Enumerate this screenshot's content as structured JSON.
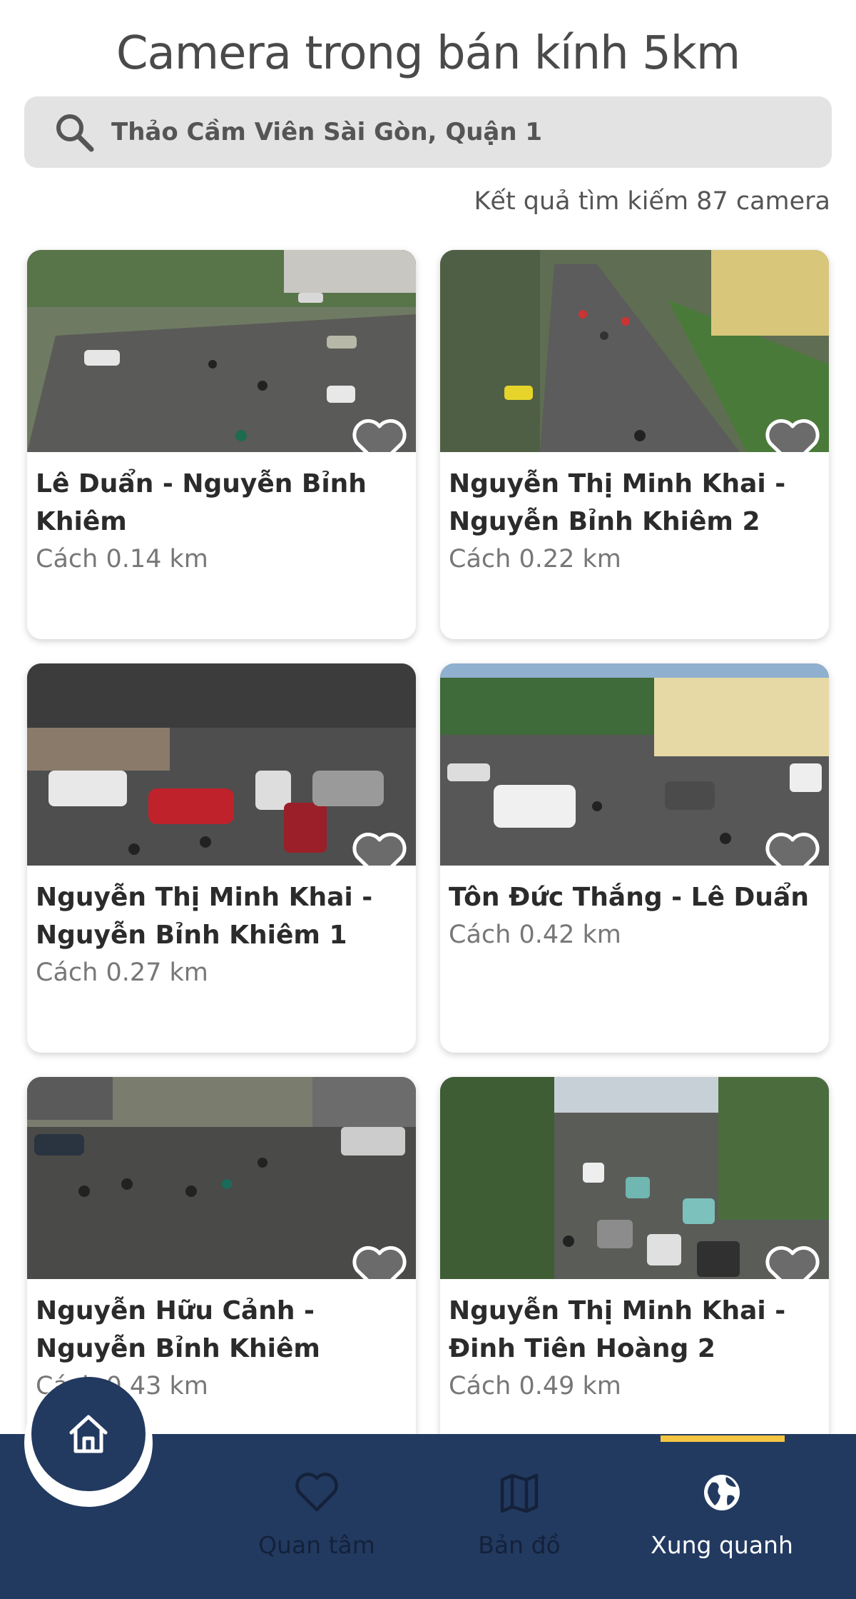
{
  "header": {
    "title": "Camera trong bán kính 5km",
    "search_value": "Thảo Cầm Viên Sài Gòn, Quận 1",
    "result_text": "Kết quả tìm kiếm 87 camera"
  },
  "cameras": [
    {
      "name": "Lê Duẩn - Nguyễn Bỉnh Khiêm",
      "distance": "Cách 0.14 km"
    },
    {
      "name": "Nguyễn Thị Minh Khai - Nguyễn Bỉnh Khiêm 2",
      "distance": "Cách 0.22 km"
    },
    {
      "name": "Nguyễn Thị Minh Khai - Nguyễn Bỉnh Khiêm 1",
      "distance": "Cách 0.27 km"
    },
    {
      "name": "Tôn Đức Thắng - Lê Duẩn",
      "distance": "Cách 0.42 km"
    },
    {
      "name": "Nguyễn Hữu Cảnh - Nguyễn Bỉnh Khiêm",
      "distance": "Cách 0.43 km"
    },
    {
      "name": "Nguyễn Thị Minh Khai - Đinh Tiên Hoàng 2",
      "distance": "Cách 0.49 km"
    }
  ],
  "nav": {
    "home_icon": "home-icon",
    "items": [
      {
        "label": "Quan tâm",
        "icon": "heart-icon"
      },
      {
        "label": "Bản đồ",
        "icon": "map-icon"
      },
      {
        "label": "Xung quanh",
        "icon": "globe-icon",
        "active": true
      }
    ]
  },
  "colors": {
    "nav_background": "#223a60",
    "active_indicator": "#f5c542",
    "search_background": "#e3e3e3"
  }
}
